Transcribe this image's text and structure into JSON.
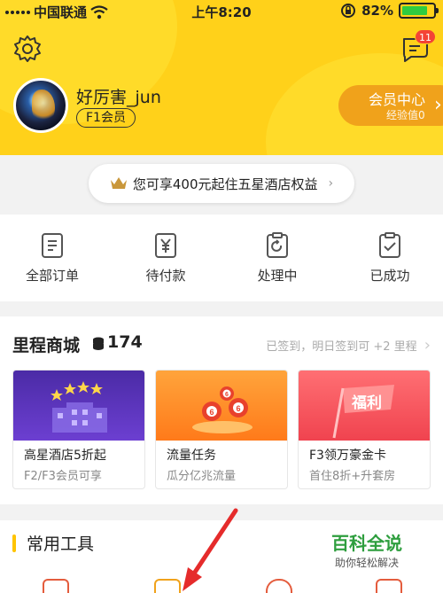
{
  "status_bar": {
    "carrier": "中国联通",
    "time": "上午8:20",
    "battery": "82%"
  },
  "header": {
    "message_badge": "11",
    "username": "好厉害_jun",
    "level": "F1会员",
    "vip_center_label": "会员中心",
    "exp_label": "经验值0"
  },
  "benefit_banner": "您可享400元起住五星酒店权益",
  "orders": [
    {
      "label": "全部订单",
      "icon": "list-icon"
    },
    {
      "label": "待付款",
      "icon": "yen-icon"
    },
    {
      "label": "处理中",
      "icon": "refresh-clipboard-icon"
    },
    {
      "label": "已成功",
      "icon": "check-clipboard-icon"
    }
  ],
  "mall": {
    "title": "里程商城",
    "count": "174",
    "sign_hint": "已签到，明日签到可 +2 里程",
    "cards": [
      {
        "name": "高星酒店5折起",
        "sub": "F2/F3会员可享"
      },
      {
        "name": "流量任务",
        "sub": "瓜分亿兆流量"
      },
      {
        "name": "F3领万豪金卡",
        "sub": "首住8折+升套房",
        "banner_text": "福利"
      }
    ]
  },
  "tools": {
    "title": "常用工具"
  },
  "watermark": {
    "title": "百科全说",
    "subtitle": "助你轻松解决"
  },
  "colors": {
    "brand_yellow": "#ffd11a",
    "vip_orange": "#f0a21b",
    "badge_red": "#f44336",
    "arrow_red": "#e52b2b"
  }
}
